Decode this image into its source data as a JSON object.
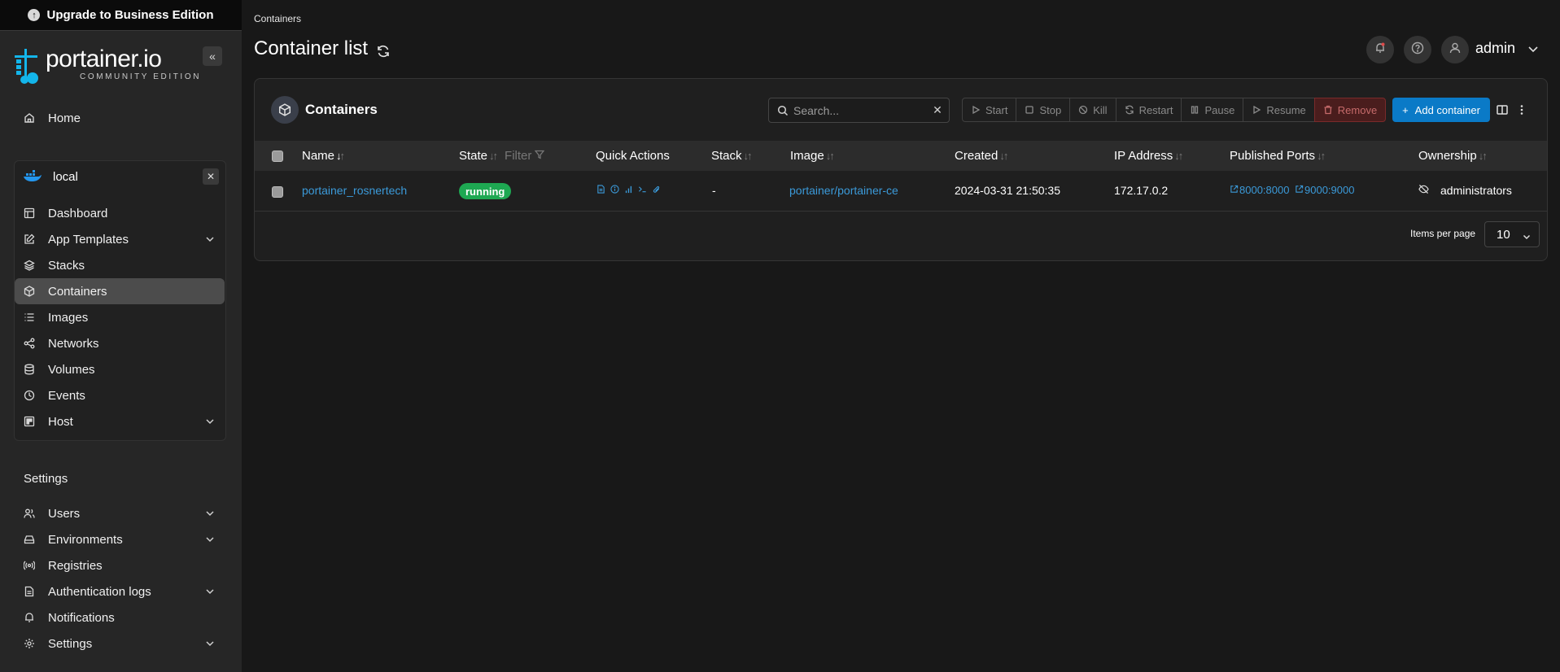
{
  "upgrade": {
    "label": "Upgrade to Business Edition"
  },
  "brand": {
    "name": "portainer.io",
    "subtitle": "COMMUNITY EDITION"
  },
  "sidebar": {
    "home": "Home",
    "environment": {
      "name": "local"
    },
    "env_items": [
      "Dashboard",
      "App Templates",
      "Stacks",
      "Containers",
      "Images",
      "Networks",
      "Volumes",
      "Events",
      "Host"
    ],
    "settings_heading": "Settings",
    "settings_items": [
      "Users",
      "Environments",
      "Registries",
      "Authentication logs",
      "Notifications",
      "Settings"
    ]
  },
  "header": {
    "breadcrumb": "Containers",
    "title": "Container list",
    "user": "admin"
  },
  "panel": {
    "title": "Containers",
    "search_placeholder": "Search...",
    "actions": [
      "Start",
      "Stop",
      "Kill",
      "Restart",
      "Pause",
      "Resume",
      "Remove"
    ],
    "add_label": "Add container"
  },
  "table": {
    "columns": [
      "Name",
      "State",
      "Quick Actions",
      "Stack",
      "Image",
      "Created",
      "IP Address",
      "Published Ports",
      "Ownership"
    ],
    "filter_label": "Filter",
    "rows": [
      {
        "name": "portainer_rosnertech",
        "state": "running",
        "stack": "-",
        "image": "portainer/portainer-ce",
        "created": "2024-03-31 21:50:35",
        "ip": "172.17.0.2",
        "ports": [
          "8000:8000",
          "9000:9000"
        ],
        "ownership": "administrators"
      }
    ]
  },
  "pagination": {
    "label": "Items per page",
    "value": "10"
  },
  "colors": {
    "accent": "#0a7ac7",
    "link": "#3b9ad9",
    "running": "#1ea852",
    "danger": "#4a1d1d"
  }
}
